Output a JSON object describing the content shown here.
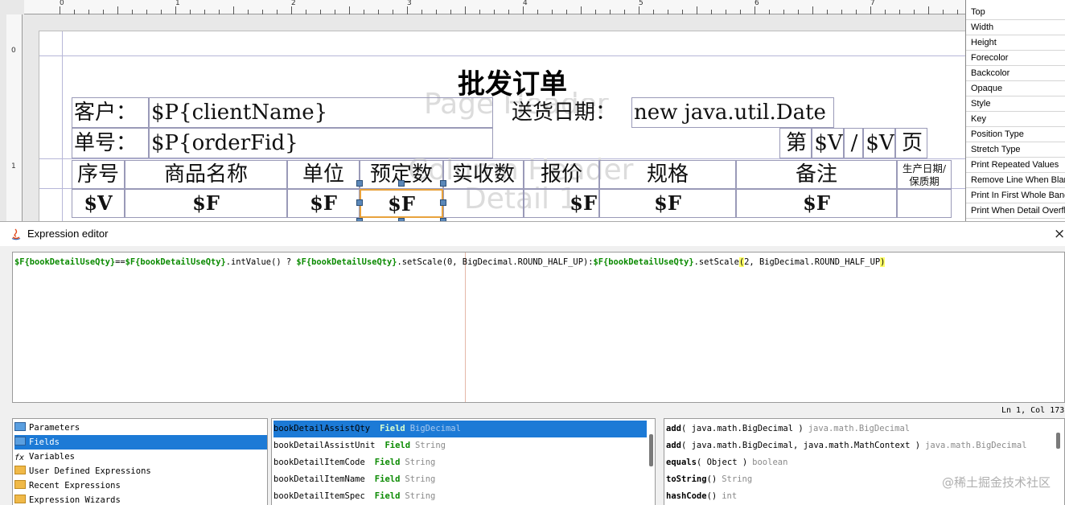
{
  "ruler": {
    "marks": [
      "0",
      "1",
      "2",
      "3",
      "4",
      "5",
      "6",
      "7"
    ]
  },
  "band_watermarks": [
    "Page Header",
    "Column Header",
    "Detail 1"
  ],
  "report": {
    "title": "批发订单",
    "client_label": "客户：",
    "client_value": "$P{clientName}",
    "date_label": "送货日期：",
    "date_value": "new java.util.Date",
    "order_label": "单号：",
    "order_value": "$P{orderFid}",
    "page_prefix": "第",
    "page_var1": "$V",
    "page_sep": "/",
    "page_var2": "$V",
    "page_suffix": "页",
    "columns": [
      "序号",
      "商品名称",
      "单位",
      "预定数",
      "实收数",
      "报价",
      "规格",
      "备注",
      "生产日期/保质期"
    ],
    "detail": [
      "$V",
      "$F",
      "$F",
      "$F",
      "",
      "$F",
      "$F",
      "$F",
      ""
    ]
  },
  "properties": [
    "Top",
    "Width",
    "Height",
    "Forecolor",
    "Backcolor",
    "Opaque",
    "Style",
    "Key",
    "Position Type",
    "Stretch Type",
    "Print Repeated Values",
    "Remove Line When Blank",
    "Print In First Whole Band",
    "Print When Detail Overflows"
  ],
  "editor": {
    "title": "Expression editor",
    "close": "×",
    "status": "Ln 1, Col 173",
    "expression": {
      "f1": "$F{bookDetailUseQty}",
      "t1": "==",
      "f2": "$F{bookDetailUseQty}",
      "t2": ".intValue() ? ",
      "f3": "$F{bookDetailUseQty}",
      "t3": ".setScale(0, BigDecimal.ROUND_HALF_UP):",
      "f4": "$F{bookDetailUseQty}",
      "t4": ".setScale",
      "t5": "(",
      "t6": "2, BigDecimal.ROUND_HALF_UP",
      "t7": ")"
    },
    "tree": [
      {
        "label": "Parameters",
        "icon": "parameters-icon"
      },
      {
        "label": "Fields",
        "icon": "fields-icon",
        "selected": true
      },
      {
        "label": "Variables",
        "icon": "variables-icon"
      },
      {
        "label": "User Defined Expressions",
        "icon": "folder-icon"
      },
      {
        "label": "Recent Expressions",
        "icon": "folder-icon"
      },
      {
        "label": "Expression Wizards",
        "icon": "folder-icon"
      }
    ],
    "fields": [
      {
        "name": "bookDetailAssistQty",
        "kind": "Field",
        "type": "BigDecimal",
        "selected": true
      },
      {
        "name": "bookDetailAssistUnit",
        "kind": "Field",
        "type": "String"
      },
      {
        "name": "bookDetailItemCode",
        "kind": "Field",
        "type": "String"
      },
      {
        "name": "bookDetailItemName",
        "kind": "Field",
        "type": "String"
      },
      {
        "name": "bookDetailItemSpec",
        "kind": "Field",
        "type": "String"
      }
    ],
    "methods": [
      {
        "name": "add",
        "args": "( java.math.BigDecimal )",
        "ret": "java.math.BigDecimal"
      },
      {
        "name": "add",
        "args": "( java.math.BigDecimal, java.math.MathContext )",
        "ret": "java.math.BigDecimal"
      },
      {
        "name": "equals",
        "args": "( Object )",
        "ret": "boolean"
      },
      {
        "name": "toString",
        "args": "()",
        "ret": "String"
      },
      {
        "name": "hashCode",
        "args": "()",
        "ret": "int"
      }
    ]
  },
  "site_watermark": "@稀土掘金技术社区"
}
